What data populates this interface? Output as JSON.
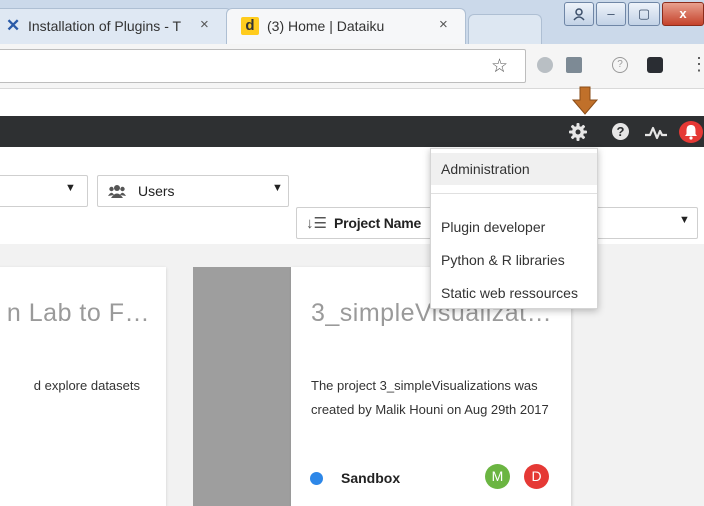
{
  "browser": {
    "tabs": [
      {
        "title": "Installation of Plugins - T",
        "close": "×"
      },
      {
        "title": "(3) Home | Dataiku",
        "close": "×",
        "icon_letter": "d"
      }
    ],
    "window_controls": {
      "min": "–",
      "max": "▢",
      "close": "x"
    },
    "toolbar": {
      "star_icon": "star-icon",
      "menu_icon": "⋮"
    }
  },
  "annotation": {
    "arrow_color": "#c0702a"
  },
  "topbar": {
    "help": "?"
  },
  "filters": {
    "users_label": "Users",
    "sort_label": "Project Name"
  },
  "admin_menu": {
    "items": [
      "Administration",
      "Plugin developer",
      "Python & R libraries",
      "Static web ressources"
    ]
  },
  "cards": [
    {
      "title": "n Lab to F…",
      "description": "d explore datasets"
    },
    {
      "title": "3_simpleVisualizat…",
      "description": "The project 3_simpleVisualizations was created by Malik Houni on Aug 29th 2017",
      "status": "Sandbox",
      "status_color": "#2d87e8",
      "avatars": [
        {
          "letter": "M",
          "color": "#6bb542"
        },
        {
          "letter": "D",
          "color": "#e53935"
        }
      ]
    }
  ],
  "colors": {
    "topbar": "#2e3032",
    "bell": "#e53935"
  }
}
